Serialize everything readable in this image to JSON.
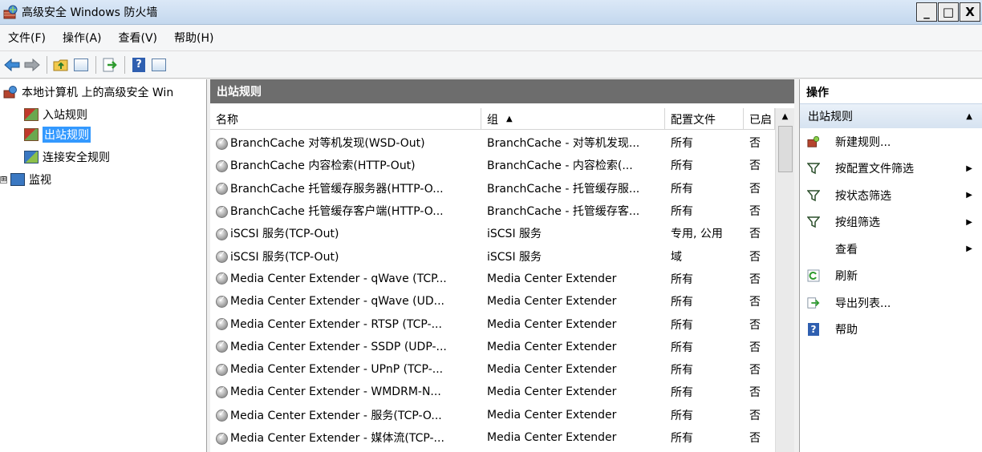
{
  "window": {
    "title": "高级安全 Windows 防火墙",
    "min": "_",
    "max": "□",
    "close": "X"
  },
  "menu": [
    "文件(F)",
    "操作(A)",
    "查看(V)",
    "帮助(H)"
  ],
  "tree": {
    "root": "本地计算机 上的高级安全 Win",
    "items": [
      {
        "label": "入站规则"
      },
      {
        "label": "出站规则",
        "selected": true
      },
      {
        "label": "连接安全规则"
      },
      {
        "label": "监视",
        "expander": "⊞"
      }
    ]
  },
  "center": {
    "title": "出站规则",
    "columns": {
      "name": "名称",
      "group": "组",
      "profile": "配置文件",
      "enabled": "已启"
    },
    "rows": [
      {
        "name": "BranchCache 对等机发现(WSD-Out)",
        "group": "BranchCache - 对等机发现...",
        "profile": "所有",
        "enabled": "否"
      },
      {
        "name": "BranchCache 内容检索(HTTP-Out)",
        "group": "BranchCache - 内容检索(...",
        "profile": "所有",
        "enabled": "否"
      },
      {
        "name": "BranchCache 托管缓存服务器(HTTP-O...",
        "group": "BranchCache - 托管缓存服...",
        "profile": "所有",
        "enabled": "否"
      },
      {
        "name": "BranchCache 托管缓存客户端(HTTP-O...",
        "group": "BranchCache - 托管缓存客...",
        "profile": "所有",
        "enabled": "否"
      },
      {
        "name": "iSCSI 服务(TCP-Out)",
        "group": "iSCSI 服务",
        "profile": "专用, 公用",
        "enabled": "否"
      },
      {
        "name": "iSCSI 服务(TCP-Out)",
        "group": "iSCSI 服务",
        "profile": "域",
        "enabled": "否"
      },
      {
        "name": "Media Center Extender - qWave (TCP...",
        "group": "Media Center Extender",
        "profile": "所有",
        "enabled": "否"
      },
      {
        "name": "Media Center Extender - qWave (UD...",
        "group": "Media Center Extender",
        "profile": "所有",
        "enabled": "否"
      },
      {
        "name": "Media Center Extender - RTSP (TCP-...",
        "group": "Media Center Extender",
        "profile": "所有",
        "enabled": "否"
      },
      {
        "name": "Media Center Extender - SSDP (UDP-...",
        "group": "Media Center Extender",
        "profile": "所有",
        "enabled": "否"
      },
      {
        "name": "Media Center Extender - UPnP (TCP-...",
        "group": "Media Center Extender",
        "profile": "所有",
        "enabled": "否"
      },
      {
        "name": "Media Center Extender - WMDRM-N...",
        "group": "Media Center Extender",
        "profile": "所有",
        "enabled": "否"
      },
      {
        "name": "Media Center Extender - 服务(TCP-O...",
        "group": "Media Center Extender",
        "profile": "所有",
        "enabled": "否"
      },
      {
        "name": "Media Center Extender - 媒体流(TCP-...",
        "group": "Media Center Extender",
        "profile": "所有",
        "enabled": "否"
      }
    ]
  },
  "actions": {
    "title": "操作",
    "section": "出站规则",
    "items": [
      {
        "label": "新建规则...",
        "icon": "new-rule-icon",
        "submenu": false
      },
      {
        "label": "按配置文件筛选",
        "icon": "filter-icon",
        "submenu": true
      },
      {
        "label": "按状态筛选",
        "icon": "filter-icon",
        "submenu": true
      },
      {
        "label": "按组筛选",
        "icon": "filter-icon",
        "submenu": true
      },
      {
        "label": "查看",
        "icon": "",
        "submenu": true
      },
      {
        "label": "刷新",
        "icon": "refresh-icon",
        "submenu": false
      },
      {
        "label": "导出列表...",
        "icon": "export-icon",
        "submenu": false
      },
      {
        "label": "帮助",
        "icon": "help-icon",
        "submenu": false
      }
    ]
  }
}
